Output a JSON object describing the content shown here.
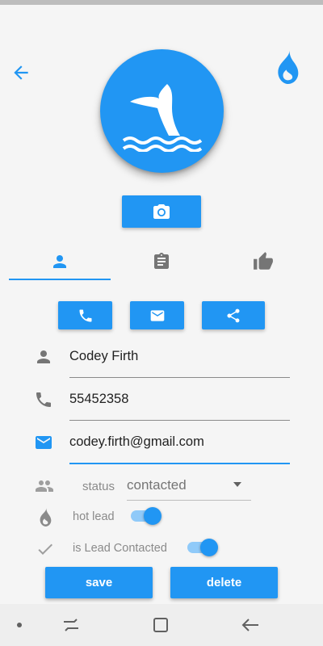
{
  "header": {
    "back_icon": "arrow-back-icon",
    "hot_icon": "flame-icon",
    "avatar_icon": "whale-tail-icon"
  },
  "photo_button_icon": "camera-icon",
  "tabs": [
    {
      "icon": "person-icon",
      "selected": true
    },
    {
      "icon": "clipboard-icon",
      "selected": false
    },
    {
      "icon": "thumbs-up-icon",
      "selected": false
    }
  ],
  "actions": [
    {
      "icon": "phone-icon"
    },
    {
      "icon": "email-icon"
    },
    {
      "icon": "share-icon"
    }
  ],
  "form": {
    "name": "Codey Firth",
    "phone": "55452358",
    "email": "codey.firth@gmail.com",
    "status_label": "status",
    "status_value": "contacted",
    "hot_lead_label": "hot lead",
    "hot_lead_on": true,
    "contacted_label": "is Lead Contacted",
    "contacted_on": true
  },
  "buttons": {
    "save": "save",
    "delete": "delete"
  },
  "colors": {
    "accent": "#2196f3",
    "accent_light": "#90caf9",
    "background": "#f5f5f5"
  }
}
